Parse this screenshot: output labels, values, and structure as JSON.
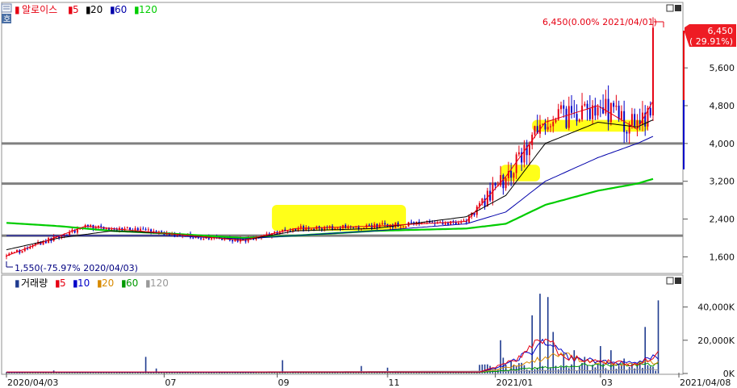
{
  "colors": {
    "up": "#e60012",
    "down": "#0000c8",
    "ma5": "#e60012",
    "ma20": "#000000",
    "ma60": "#0000aa",
    "ma120": "#00cc00",
    "vma5": "#e60012",
    "vma10": "#0000c8",
    "vma20": "#d88a00",
    "vma60": "#009900",
    "vma120": "#999999",
    "volume_bar": "#1f3b8f",
    "highlight": "#ffff00",
    "hline": "#808080",
    "price_tag": "#ee1c24"
  },
  "price_panel": {
    "legend": {
      "name": "알로이스",
      "items": [
        {
          "label": "5",
          "color": "#e60012"
        },
        {
          "label": "20",
          "color": "#000000"
        },
        {
          "label": "60",
          "color": "#0000aa"
        },
        {
          "label": "120",
          "color": "#00cc00"
        }
      ]
    },
    "high_annotation": "6,450(0.00% 2021/04/01)",
    "low_annotation": "1,550(-75.97% 2020/04/03)",
    "current_price_tag": {
      "price": "6,450",
      "change": "( 29.91%)"
    }
  },
  "volume_panel": {
    "legend": {
      "name": "거래량",
      "items": [
        {
          "label": "5",
          "color": "#e60012"
        },
        {
          "label": "10",
          "color": "#0000c8"
        },
        {
          "label": "20",
          "color": "#d88a00"
        },
        {
          "label": "60",
          "color": "#009900"
        },
        {
          "label": "120",
          "color": "#999999"
        }
      ]
    }
  },
  "x_axis_labels": [
    {
      "label": "2020/04/03",
      "index": 0
    },
    {
      "label": "07",
      "index": 60
    },
    {
      "label": "09",
      "index": 103
    },
    {
      "label": "11",
      "index": 145
    },
    {
      "label": "2021/01",
      "index": 186
    },
    {
      "label": "03",
      "index": 226
    },
    {
      "label": "2021/04/08",
      "index": 250
    }
  ],
  "chart_data": [
    {
      "type": "candlestick",
      "title": "",
      "y_ticks": [
        1600,
        2400,
        3200,
        4000,
        4800,
        5600
      ],
      "y_tick_labels": [
        "1,600",
        "2,400",
        "3,200",
        "4,000",
        "4,800",
        "5,600"
      ],
      "ylim": [
        1300,
        6900
      ],
      "x_range": [
        0,
        250
      ],
      "horizontal_lines": [
        4000,
        3150,
        2050
      ],
      "highlight_zones": [
        {
          "x": [
            101,
            152
          ],
          "y": [
            2150,
            2700
          ]
        },
        {
          "x": [
            188,
            203
          ],
          "y": [
            3200,
            3550
          ]
        },
        {
          "x": [
            200,
            244
          ],
          "y": [
            4250,
            4500
          ]
        }
      ],
      "candles": [],
      "ma_keypoints": {
        "ma5": [
          [
            0,
            1620
          ],
          [
            30,
            2250
          ],
          [
            60,
            2100
          ],
          [
            90,
            1950
          ],
          [
            110,
            2200
          ],
          [
            140,
            2250
          ],
          [
            175,
            2350
          ],
          [
            190,
            3300
          ],
          [
            205,
            4450
          ],
          [
            225,
            4800
          ],
          [
            240,
            4300
          ],
          [
            246,
            4900
          ]
        ],
        "ma20": [
          [
            0,
            1750
          ],
          [
            20,
            2000
          ],
          [
            40,
            2150
          ],
          [
            60,
            2100
          ],
          [
            90,
            1950
          ],
          [
            110,
            2150
          ],
          [
            140,
            2200
          ],
          [
            175,
            2450
          ],
          [
            190,
            2900
          ],
          [
            205,
            4000
          ],
          [
            225,
            4450
          ],
          [
            240,
            4350
          ],
          [
            246,
            4500
          ]
        ],
        "ma60": [
          [
            0,
            2050
          ],
          [
            20,
            2050
          ],
          [
            40,
            2050
          ],
          [
            60,
            2050
          ],
          [
            90,
            1980
          ],
          [
            110,
            2050
          ],
          [
            140,
            2150
          ],
          [
            175,
            2300
          ],
          [
            190,
            2550
          ],
          [
            205,
            3200
          ],
          [
            225,
            3700
          ],
          [
            240,
            4000
          ],
          [
            246,
            4150
          ]
        ],
        "ma120": [
          [
            0,
            2320
          ],
          [
            20,
            2250
          ],
          [
            40,
            2150
          ],
          [
            60,
            2100
          ],
          [
            90,
            2000
          ],
          [
            110,
            2050
          ],
          [
            140,
            2150
          ],
          [
            175,
            2200
          ],
          [
            190,
            2300
          ],
          [
            205,
            2700
          ],
          [
            225,
            3000
          ],
          [
            240,
            3150
          ],
          [
            246,
            3250
          ]
        ]
      }
    },
    {
      "type": "bar",
      "title": "",
      "y_ticks": [
        0,
        20000,
        40000
      ],
      "y_tick_labels": [
        "0K",
        "20,000K",
        "40,000K"
      ],
      "ylim": [
        0,
        50000
      ],
      "x_range": [
        0,
        250
      ],
      "spikes": [
        [
          18,
          1800
        ],
        [
          53,
          10000
        ],
        [
          57,
          3000
        ],
        [
          105,
          8000
        ],
        [
          135,
          4500
        ],
        [
          145,
          3500
        ],
        [
          186,
          3000
        ],
        [
          188,
          20000
        ],
        [
          189,
          9500
        ],
        [
          192,
          8000
        ],
        [
          197,
          5000
        ],
        [
          200,
          35000
        ],
        [
          203,
          48000
        ],
        [
          206,
          46000
        ],
        [
          208,
          25000
        ],
        [
          212,
          12000
        ],
        [
          216,
          14000
        ],
        [
          220,
          10000
        ],
        [
          226,
          16500
        ],
        [
          230,
          14000
        ],
        [
          235,
          9000
        ],
        [
          240,
          6000
        ],
        [
          243,
          28000
        ],
        [
          246,
          4000
        ],
        [
          248,
          44000
        ]
      ],
      "ma_keypoints": {
        "vma5": [
          [
            0,
            900
          ],
          [
            180,
            900
          ],
          [
            186,
            4000
          ],
          [
            195,
            9000
          ],
          [
            205,
            22000
          ],
          [
            212,
            10000
          ],
          [
            220,
            8000
          ],
          [
            230,
            7000
          ],
          [
            240,
            5000
          ],
          [
            248,
            12000
          ]
        ],
        "vma10": [
          [
            0,
            700
          ],
          [
            180,
            800
          ],
          [
            190,
            5000
          ],
          [
            205,
            18000
          ],
          [
            215,
            9000
          ],
          [
            225,
            7500
          ],
          [
            235,
            6000
          ],
          [
            248,
            10000
          ]
        ],
        "vma20": [
          [
            0,
            650
          ],
          [
            180,
            700
          ],
          [
            195,
            5000
          ],
          [
            210,
            12000
          ],
          [
            220,
            8000
          ],
          [
            235,
            5000
          ],
          [
            248,
            7000
          ]
        ],
        "vma60": [
          [
            0,
            600
          ],
          [
            180,
            650
          ],
          [
            200,
            3000
          ],
          [
            220,
            5000
          ],
          [
            248,
            5500
          ]
        ],
        "vma120": [
          [
            0,
            500
          ],
          [
            200,
            1500
          ],
          [
            248,
            2500
          ]
        ]
      }
    }
  ]
}
